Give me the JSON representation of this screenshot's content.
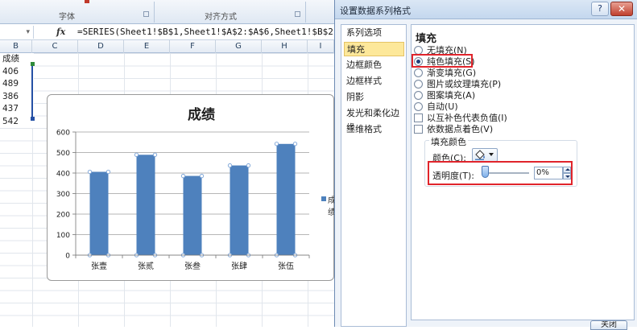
{
  "excel": {
    "ribbon": {
      "font_group": "字体",
      "alignment_group": "对齐方式"
    },
    "formula_bar": {
      "fx": "fx",
      "formula": "=SERIES(Sheet1!$B$1,Sheet1!$A$2:$A$6,Sheet1!$B$2:$B$6,1)"
    },
    "columns": [
      "B",
      "C",
      "D",
      "E",
      "F",
      "G",
      "H",
      "I"
    ],
    "cells": [
      "成绩",
      "406",
      "489",
      "386",
      "437",
      "542"
    ]
  },
  "chart_data": {
    "type": "bar",
    "title": "成绩",
    "categories": [
      "张壹",
      "张贰",
      "张叁",
      "张肆",
      "张伍"
    ],
    "values": [
      406,
      489,
      386,
      437,
      542
    ],
    "ylim": [
      0,
      600
    ],
    "yticks": [
      0,
      100,
      200,
      300,
      400,
      500,
      600
    ],
    "xlabel": "",
    "ylabel": "",
    "grid": true,
    "legend_placement": "right",
    "legend_text": "成绩",
    "bar_color": "#4e81bd"
  },
  "dialog": {
    "title": "设置数据系列格式",
    "help": "?",
    "close": "✕",
    "nav": [
      "系列选项",
      "填充",
      "边框颜色",
      "边框样式",
      "阴影",
      "发光和柔化边缘",
      "三维格式"
    ],
    "selected_nav": "填充",
    "panel_heading": "填充",
    "options": [
      {
        "kind": "radio",
        "label": "无填充(N)",
        "checked": false
      },
      {
        "kind": "radio",
        "label": "纯色填充(S)",
        "checked": true
      },
      {
        "kind": "radio",
        "label": "渐变填充(G)",
        "checked": false
      },
      {
        "kind": "radio",
        "label": "图片或纹理填充(P)",
        "checked": false
      },
      {
        "kind": "radio",
        "label": "图案填充(A)",
        "checked": false
      },
      {
        "kind": "radio",
        "label": "自动(U)",
        "checked": false
      },
      {
        "kind": "checkbox",
        "label": "以互补色代表负值(I)",
        "checked": false
      },
      {
        "kind": "checkbox",
        "label": "依数据点着色(V)",
        "checked": false
      }
    ],
    "fill_color": {
      "legend": "填充颜色",
      "color_label": "颜色(C):",
      "transparency_label": "透明度(T):",
      "transparency_value": "0%",
      "transparency_fraction": 0
    },
    "close_button": "关闭",
    "highlight_color": "#e0242b"
  }
}
